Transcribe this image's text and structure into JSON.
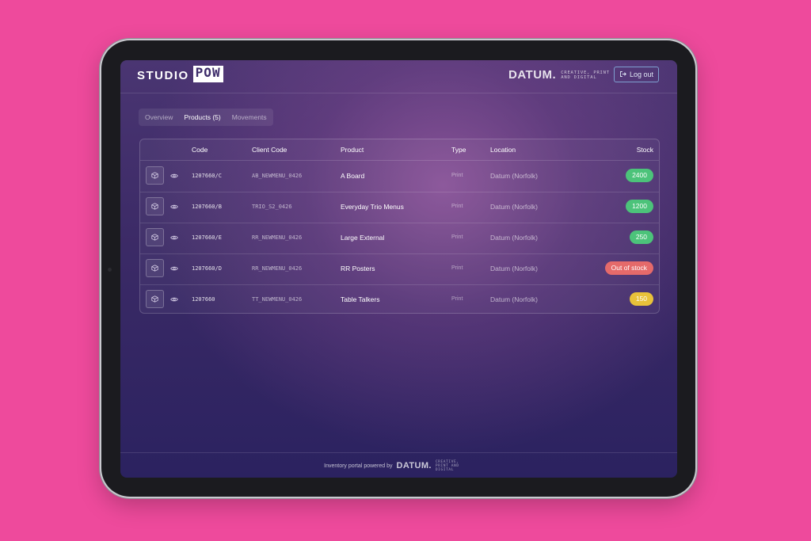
{
  "brand": {
    "studio": "STUDIO",
    "pow": "POW"
  },
  "partner": {
    "name": "DATUM.",
    "tagline": "CREATIVE, PRINT AND DIGITAL"
  },
  "header": {
    "logout_label": "Log out"
  },
  "tabs": [
    {
      "label": "Overview",
      "active": false
    },
    {
      "label": "Products (5)",
      "active": true
    },
    {
      "label": "Movements",
      "active": false
    }
  ],
  "table": {
    "columns": [
      "Code",
      "Client Code",
      "Product",
      "Type",
      "Location",
      "Stock"
    ],
    "rows": [
      {
        "code": "1207660/C",
        "client_code": "AB_NEWMENU_0426",
        "product": "A Board",
        "type": "Print",
        "location": "Datum (Norfolk)",
        "stock": "2400",
        "status_color": "#4cc37a"
      },
      {
        "code": "1207660/B",
        "client_code": "TRIO_S2_0426",
        "product": "Everyday Trio Menus",
        "type": "Print",
        "location": "Datum (Norfolk)",
        "stock": "1200",
        "status_color": "#4cc37a"
      },
      {
        "code": "1207660/E",
        "client_code": "RR_NEWMENU_0426",
        "product": "Large External",
        "type": "Print",
        "location": "Datum (Norfolk)",
        "stock": "250",
        "status_color": "#4cc37a"
      },
      {
        "code": "1207660/D",
        "client_code": "RR_NEWMENU_0426",
        "product": "RR Posters",
        "type": "Print",
        "location": "Datum (Norfolk)",
        "stock": "Out of stock",
        "status_color": "#e56a6a"
      },
      {
        "code": "1207660",
        "client_code": "TT_NEWMENU_0426",
        "product": "Table Talkers",
        "type": "Print",
        "location": "Datum (Norfolk)",
        "stock": "150",
        "status_color": "#e8c23a"
      }
    ]
  },
  "footer": {
    "text": "Inventory portal powered by",
    "brand": "DATUM.",
    "tagline": "CREATIVE, PRINT AND DIGITAL"
  },
  "colors": {
    "background": "#ee4a9c",
    "accent_border": "#7ea0d0"
  },
  "icons": {
    "logout": "logout-icon",
    "box": "box-icon",
    "view": "eye-icon"
  }
}
